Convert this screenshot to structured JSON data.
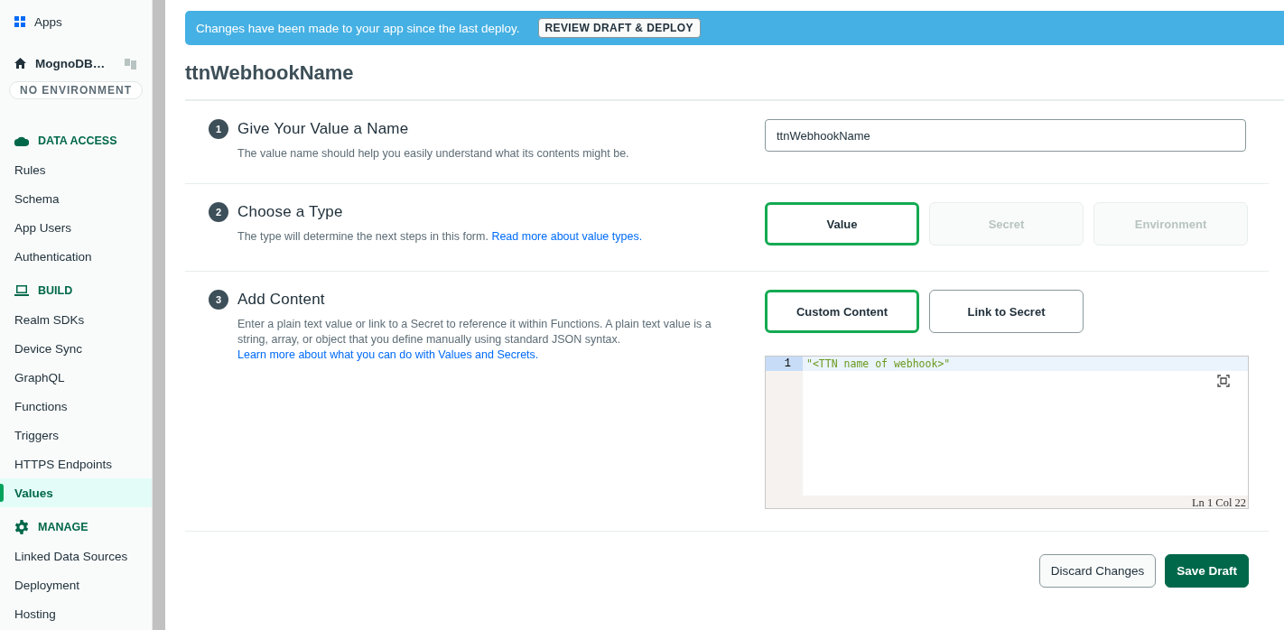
{
  "sidebar": {
    "apps_link": "Apps",
    "app_name": "MognoDB…",
    "environment_badge": "NO ENVIRONMENT",
    "sections": [
      {
        "title": "DATA ACCESS",
        "kind": "cloud",
        "items": [
          {
            "label": "Rules",
            "selected": false
          },
          {
            "label": "Schema",
            "selected": false
          },
          {
            "label": "App Users",
            "selected": false
          },
          {
            "label": "Authentication",
            "selected": false
          }
        ]
      },
      {
        "title": "BUILD",
        "kind": "laptop",
        "items": [
          {
            "label": "Realm SDKs",
            "selected": false
          },
          {
            "label": "Device Sync",
            "selected": false
          },
          {
            "label": "GraphQL",
            "selected": false
          },
          {
            "label": "Functions",
            "selected": false
          },
          {
            "label": "Triggers",
            "selected": false
          },
          {
            "label": "HTTPS Endpoints",
            "selected": false
          },
          {
            "label": "Values",
            "selected": true
          }
        ]
      },
      {
        "title": "MANAGE",
        "kind": "gear",
        "items": [
          {
            "label": "Linked Data Sources",
            "selected": false
          },
          {
            "label": "Deployment",
            "selected": false
          },
          {
            "label": "Hosting",
            "selected": false
          }
        ]
      }
    ]
  },
  "banner": {
    "text": "Changes have been made to your app since the last deploy.",
    "button": "REVIEW DRAFT & DEPLOY"
  },
  "title": "ttnWebhookName",
  "steps": [
    {
      "kind": "name",
      "number": "1",
      "title": "Give Your Value a Name",
      "description": "The value name should help you easily understand what its contents might be.",
      "field": {
        "value": "ttnWebhookName"
      }
    },
    {
      "kind": "choice",
      "number": "2",
      "title": "Choose a Type",
      "description": "The type will determine the next steps in this form.",
      "link": "Read more about value types.",
      "options": [
        {
          "label": "Value",
          "selected": true,
          "disabled": false
        },
        {
          "label": "Secret",
          "selected": false,
          "disabled": true
        },
        {
          "label": "Environment",
          "selected": false,
          "disabled": true
        }
      ]
    },
    {
      "kind": "content",
      "number": "3",
      "title": "Add Content",
      "description": "Enter a plain text value or link to a Secret to reference it within Functions. A plain text value is a string, array, or object that you define manually using standard JSON syntax.",
      "link": "Learn more about what you can do with Values and Secrets.",
      "options": [
        {
          "label": "Custom Content",
          "selected": true,
          "disabled": false
        },
        {
          "label": "Link to Secret",
          "selected": false,
          "disabled": false
        }
      ],
      "editor": {
        "line_number": "1",
        "code": "\"<TTN name of webhook>\"",
        "status": "Ln 1 Col 22"
      }
    }
  ],
  "footer": [
    {
      "label": "Discard Changes",
      "kind": "secondary"
    },
    {
      "label": "Save Draft",
      "kind": "primary"
    }
  ]
}
